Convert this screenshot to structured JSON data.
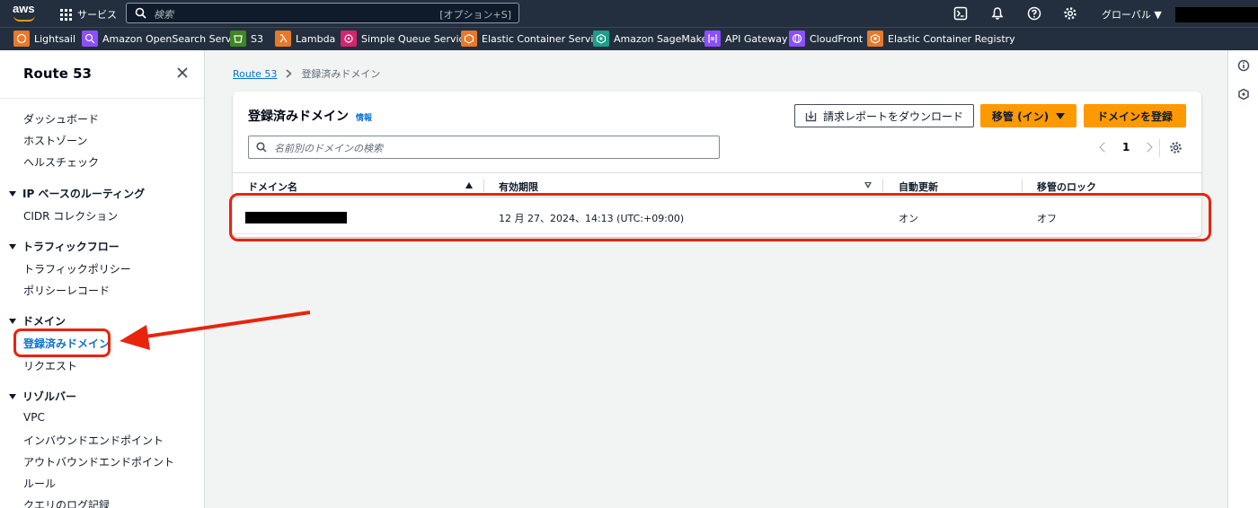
{
  "topnav": {
    "logo_text": "aws",
    "services_label": "サービス",
    "search_placeholder": "検索",
    "search_shortcut": "[オプション+S]",
    "region_label": "グローバル ▼"
  },
  "favorites": [
    {
      "label": "Lightsail",
      "color": "#e7792b",
      "icon": "lightsail-icon"
    },
    {
      "label": "Amazon OpenSearch Service",
      "color": "#8c4fff",
      "icon": "opensearch-icon"
    },
    {
      "label": "S3",
      "color": "#3f8624",
      "icon": "s3-icon"
    },
    {
      "label": "Lambda",
      "color": "#e7792b",
      "icon": "lambda-icon"
    },
    {
      "label": "Simple Queue Service",
      "color": "#d6246e",
      "icon": "sqs-icon"
    },
    {
      "label": "Elastic Container Service",
      "color": "#e7792b",
      "icon": "ecs-icon"
    },
    {
      "label": "Amazon SageMaker",
      "color": "#1b9e8a",
      "icon": "sagemaker-icon"
    },
    {
      "label": "API Gateway",
      "color": "#8c4fff",
      "icon": "api-gateway-icon"
    },
    {
      "label": "CloudFront",
      "color": "#8c4fff",
      "icon": "cloudfront-icon"
    },
    {
      "label": "Elastic Container Registry",
      "color": "#e7792b",
      "icon": "ecr-icon"
    }
  ],
  "sidebar": {
    "title": "Route 53",
    "items": {
      "dashboard": "ダッシュボード",
      "hosted_zones": "ホストゾーン",
      "health_checks": "ヘルスチェック",
      "ip_routing": "IP ベースのルーティング",
      "cidr": "CIDR コレクション",
      "traffic_flow": "トラフィックフロー",
      "traffic_policy": "トラフィックポリシー",
      "policy_records": "ポリシーレコード",
      "domains": "ドメイン",
      "registered_domains": "登録済みドメイン",
      "requests": "リクエスト",
      "resolver": "リゾルバー",
      "vpc": "VPC",
      "inbound": "インバウンドエンドポイント",
      "outbound": "アウトバウンドエンドポイント",
      "rules": "ルール",
      "query_logging": "クエリのログ記録"
    }
  },
  "breadcrumb": {
    "root": "Route 53",
    "current": "登録済みドメイン"
  },
  "panel": {
    "title": "登録済みドメイン",
    "info": "情報",
    "download_label": "請求レポートをダウンロード",
    "transfer_label": "移管 (イン)",
    "register_label": "ドメインを登録",
    "filter_placeholder": "名前別のドメインの検索",
    "page_number": "1",
    "columns": [
      "ドメイン名",
      "有効期限",
      "自動更新",
      "移管のロック"
    ],
    "row": {
      "expiry": "12 月 27、2024、14:13 (UTC:+09:00)",
      "auto_renew": "オン",
      "transfer_lock": "オフ"
    }
  },
  "colors": {
    "nav_bg": "#232f3e",
    "accent_orange": "#ff9900",
    "link_blue": "#0972d3",
    "highlight_red": "#e8240c"
  }
}
